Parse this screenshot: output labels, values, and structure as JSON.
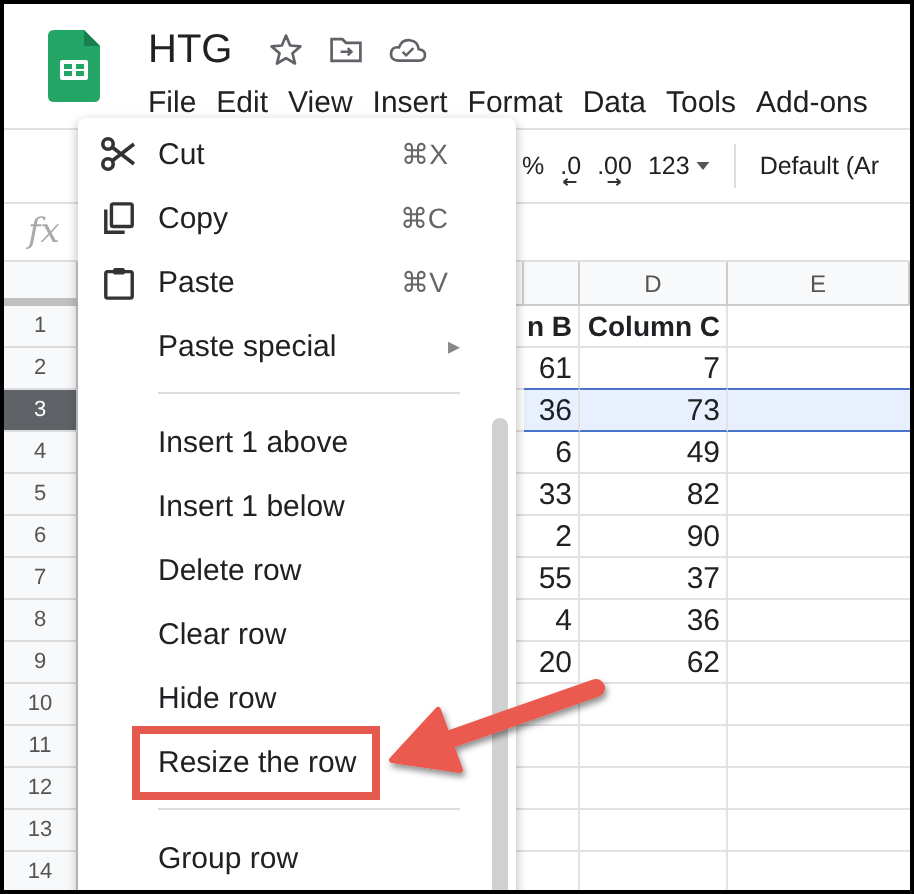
{
  "doc": {
    "title": "HTG"
  },
  "menu_bar": [
    "File",
    "Edit",
    "View",
    "Insert",
    "Format",
    "Data",
    "Tools",
    "Add-ons"
  ],
  "toolbar": {
    "percent": "%",
    "decrease_decimals": ".0",
    "increase_decimals": ".00",
    "number_format": "123",
    "font": "Default (Ar"
  },
  "formula_bar": {
    "label": "fx"
  },
  "sheet": {
    "columns": [
      "D",
      "E"
    ],
    "rows": [
      {
        "number": "1",
        "selected": false,
        "kind": "header",
        "cells": [
          "n B",
          "Column C"
        ]
      },
      {
        "number": "2",
        "selected": false,
        "kind": "data",
        "cells": [
          "61",
          "7"
        ]
      },
      {
        "number": "3",
        "selected": true,
        "kind": "data",
        "cells": [
          "36",
          "73"
        ]
      },
      {
        "number": "4",
        "selected": false,
        "kind": "data",
        "cells": [
          "6",
          "49"
        ]
      },
      {
        "number": "5",
        "selected": false,
        "kind": "data",
        "cells": [
          "33",
          "82"
        ]
      },
      {
        "number": "6",
        "selected": false,
        "kind": "data",
        "cells": [
          "2",
          "90"
        ]
      },
      {
        "number": "7",
        "selected": false,
        "kind": "data",
        "cells": [
          "55",
          "37"
        ]
      },
      {
        "number": "8",
        "selected": false,
        "kind": "data",
        "cells": [
          "4",
          "36"
        ]
      },
      {
        "number": "9",
        "selected": false,
        "kind": "data",
        "cells": [
          "20",
          "62"
        ]
      },
      {
        "number": "10",
        "selected": false,
        "kind": "data"
      },
      {
        "number": "11",
        "selected": false,
        "kind": "data"
      },
      {
        "number": "12",
        "selected": false,
        "kind": "data"
      },
      {
        "number": "13",
        "selected": false,
        "kind": "data"
      },
      {
        "number": "14",
        "selected": false,
        "kind": "data"
      }
    ]
  },
  "context_menu": {
    "items": [
      {
        "kind": "command",
        "label": "Cut",
        "shortcut": "⌘X"
      },
      {
        "kind": "command",
        "label": "Copy",
        "shortcut": "⌘C"
      },
      {
        "kind": "command",
        "label": "Paste",
        "shortcut": "⌘V"
      },
      {
        "kind": "submenu",
        "label": "Paste special",
        "arrow": "▸"
      },
      {
        "kind": "divider"
      },
      {
        "kind": "command",
        "label": "Insert 1 above"
      },
      {
        "kind": "command",
        "label": "Insert 1 below"
      },
      {
        "kind": "command",
        "label": "Delete row"
      },
      {
        "kind": "command",
        "label": "Clear row"
      },
      {
        "kind": "command",
        "label": "Hide row"
      },
      {
        "kind": "command",
        "label": "Resize the row",
        "highlighted": true
      },
      {
        "kind": "divider"
      },
      {
        "kind": "command",
        "label": "Group row"
      }
    ]
  }
}
